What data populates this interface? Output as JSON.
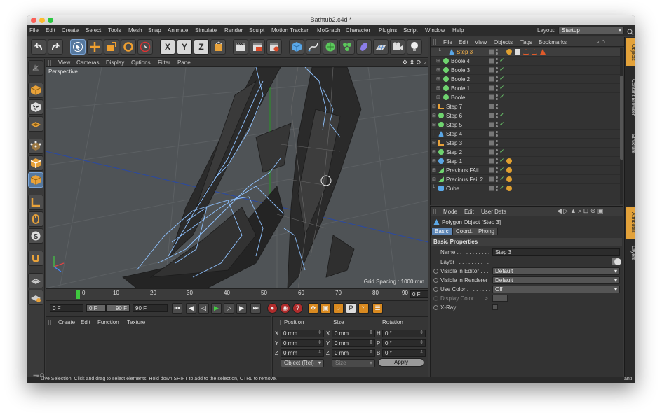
{
  "window": {
    "title": "Bathtub2.c4d *"
  },
  "menu": [
    "File",
    "Edit",
    "Create",
    "Select",
    "Tools",
    "Mesh",
    "Snap",
    "Animate",
    "Simulate",
    "Render",
    "Sculpt",
    "Motion Tracker",
    "MoGraph",
    "Character",
    "Plugins",
    "Script",
    "Window",
    "Help"
  ],
  "layout": {
    "label": "Layout:",
    "value": "Startup"
  },
  "toolbar": {
    "axis_x": "X",
    "axis_y": "Y",
    "axis_z": "Z",
    "icons": [
      "undo-icon",
      "redo-icon",
      "live-selection-icon",
      "move-icon",
      "scale-icon",
      "rotate-icon",
      "recent-tool-icon",
      "x-axis-icon",
      "y-axis-icon",
      "z-axis-icon",
      "coordinate-system-icon",
      "render-view-icon",
      "render-picture-viewer-icon",
      "edit-render-settings-icon",
      "cube-icon",
      "spline-pen-icon",
      "subdivision-surface-icon",
      "array-icon",
      "deformer-icon",
      "floor-icon",
      "camera-icon",
      "light-icon"
    ]
  },
  "viewport": {
    "menu": [
      "View",
      "Cameras",
      "Display",
      "Options",
      "Filter",
      "Panel"
    ],
    "label": "Perspective",
    "grid_spacing": "Grid Spacing : 1000 mm"
  },
  "timeline": {
    "ticks": [
      "0",
      "10",
      "20",
      "30",
      "40",
      "50",
      "60",
      "70",
      "80",
      "90"
    ],
    "current_frame": "0 F"
  },
  "transport": {
    "start": "0 F",
    "range_start": "0 F",
    "range_end": "90 F",
    "end": "90 F"
  },
  "material_menu": [
    "Create",
    "Edit",
    "Function",
    "Texture"
  ],
  "coordinates": {
    "headers": [
      "Position",
      "Size",
      "Rotation"
    ],
    "rows": [
      {
        "pl": "X",
        "pv": "0 mm",
        "sl": "X",
        "sv": "0 mm",
        "rl": "H",
        "rv": "0 °"
      },
      {
        "pl": "Y",
        "pv": "0 mm",
        "sl": "Y",
        "sv": "0 mm",
        "rl": "P",
        "rv": "0 °"
      },
      {
        "pl": "Z",
        "pv": "0 mm",
        "sl": "Z",
        "sv": "0 mm",
        "rl": "B",
        "rv": "0 °"
      }
    ],
    "mode": "Object (Rel)",
    "size_mode": "Size",
    "apply": "Apply"
  },
  "status": "Live Selection: Click and drag to select elements. Hold down SHIFT to add to the selection, CTRL to remove.",
  "objects": {
    "menu": [
      "File",
      "Edit",
      "View",
      "Objects",
      "Tags",
      "Bookmarks"
    ],
    "items": [
      {
        "name": "Step 3",
        "selected": true
      },
      {
        "name": "Boole.4"
      },
      {
        "name": "Boole.3"
      },
      {
        "name": "Boole.2"
      },
      {
        "name": "Boole.1"
      },
      {
        "name": "Boole"
      },
      {
        "name": "Step 7"
      },
      {
        "name": "Step 6"
      },
      {
        "name": "Step 5"
      },
      {
        "name": "Step 4"
      },
      {
        "name": "Step 3"
      },
      {
        "name": "Step 2"
      },
      {
        "name": "Step 1"
      },
      {
        "name": "Previous FAil"
      },
      {
        "name": "Precious Fail 2"
      },
      {
        "name": "Cube"
      }
    ]
  },
  "side_tabs": [
    "Objects",
    "Content Browser",
    "Structure"
  ],
  "side_tabs_lower": [
    "Attributes",
    "Layers"
  ],
  "attributes": {
    "menu": [
      "Mode",
      "Edit",
      "User Data"
    ],
    "title": "Polygon Object [Step 3]",
    "tabs": [
      "Basic",
      "Coord.",
      "Phong"
    ],
    "section": "Basic Properties",
    "props": [
      {
        "label": "Name . . . . . . . . . . .",
        "value": "Step 3"
      },
      {
        "label": "Layer . . . . . . . . . . .",
        "value": ""
      },
      {
        "label": "Visible in Editor . . .",
        "value": "Default"
      },
      {
        "label": "Visible in Renderer",
        "value": "Default"
      },
      {
        "label": "Use Color . . . . . . . .",
        "value": "Off"
      },
      {
        "label": "Display Color . . . >",
        "value": ""
      },
      {
        "label": "X-Ray . . . . . . . . . . .",
        "value": ""
      }
    ]
  },
  "brand": "MAXON CINEMA 4D",
  "clipped_text": "anti"
}
